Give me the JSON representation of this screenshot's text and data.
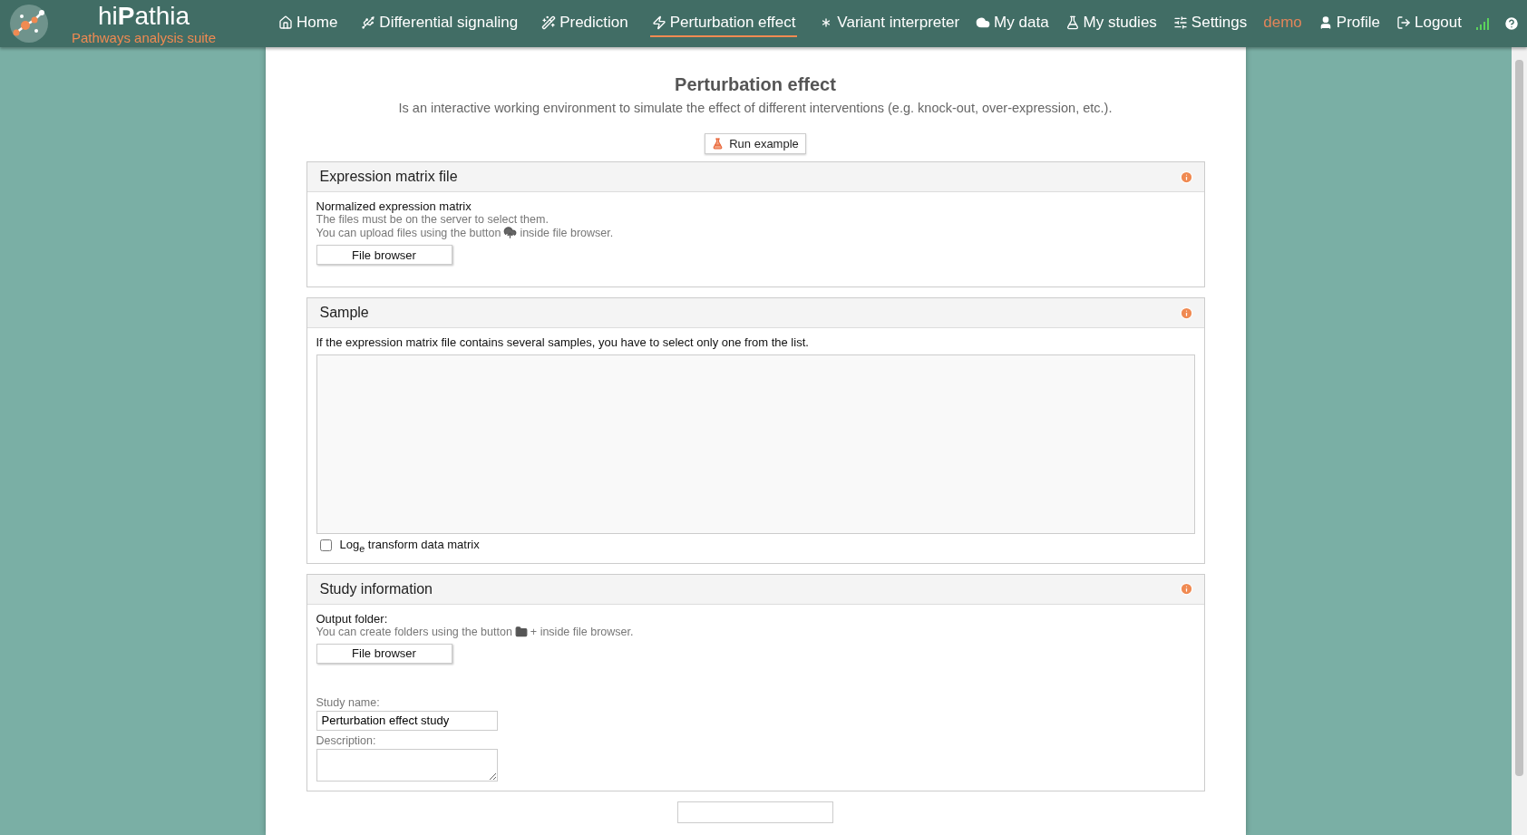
{
  "brand": {
    "name_plain": "hi",
    "name_bold": "P",
    "name_rest": "athia",
    "tagline": "Pathways analysis suite"
  },
  "nav_left": [
    {
      "label": "Home",
      "selected": false
    },
    {
      "label": "Differential signaling",
      "selected": false
    },
    {
      "label": "Prediction",
      "selected": false
    },
    {
      "label": "Perturbation effect",
      "selected": true
    },
    {
      "label": "Variant interpreter",
      "selected": false
    }
  ],
  "nav_right": [
    {
      "kind": "link",
      "label": "My data"
    },
    {
      "kind": "link",
      "label": "My studies"
    },
    {
      "kind": "link",
      "label": "Settings"
    },
    {
      "kind": "user",
      "label": "demo"
    },
    {
      "kind": "link",
      "label": "Profile"
    },
    {
      "kind": "link",
      "label": "Logout"
    }
  ],
  "page": {
    "title": "Perturbation effect",
    "subtitle": "Is an interactive working environment to simulate the effect of different interventions (e.g. knock-out, over-expression, etc.).",
    "run_example": "Run example"
  },
  "expression_panel": {
    "title": "Expression matrix file",
    "field_label": "Normalized expression matrix",
    "help_1": "The files must be on the server to select them.",
    "help_2_before": "You can upload files using the button",
    "help_2_after": "inside file browser.",
    "button": "File browser"
  },
  "sample_panel": {
    "title": "Sample",
    "help": "If the expression matrix file contains several samples, you have to select only one from the list.",
    "log_transform": {
      "label": "Log$_{e}$ transform data matrix",
      "checked": false
    }
  },
  "study_panel": {
    "title": "Study information",
    "output_label": "Output folder:",
    "help_before": "You can create folders using the button",
    "help_after": "+ inside file browser.",
    "button": "File browser",
    "study_name_label": "Study name:",
    "study_name_value": "Perturbation effect study",
    "description_label": "Description:"
  }
}
